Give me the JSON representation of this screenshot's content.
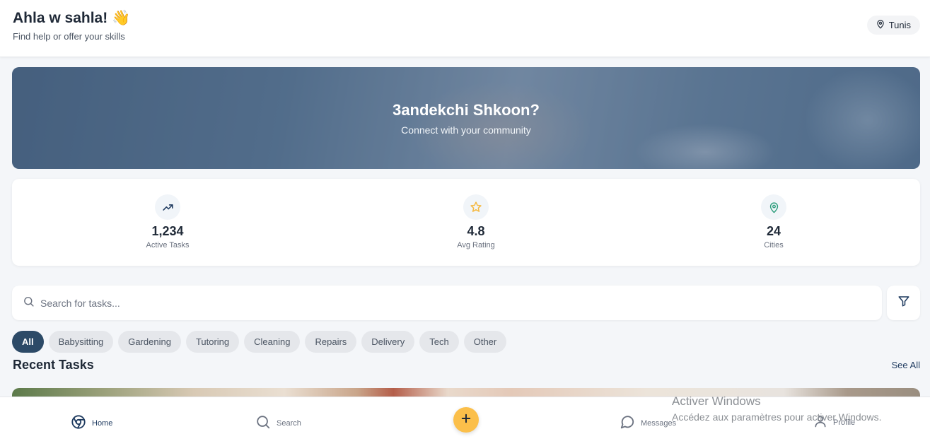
{
  "header": {
    "greeting": "Ahla w sahla! 👋",
    "subtitle": "Find help or offer your skills",
    "location": "Tunis",
    "location_icon": "map-pin-icon"
  },
  "hero": {
    "title": "3andekchi Shkoon?",
    "subtitle": "Connect with your community"
  },
  "stats": [
    {
      "icon": "trending-up-icon",
      "value": "1,234",
      "label": "Active Tasks",
      "color": "#1e3a5f"
    },
    {
      "icon": "star-icon",
      "value": "4.8",
      "label": "Avg Rating",
      "color": "#f5b942"
    },
    {
      "icon": "map-pin-icon",
      "value": "24",
      "label": "Cities",
      "color": "#2f9e7e"
    }
  ],
  "search": {
    "placeholder": "Search for tasks...",
    "value": ""
  },
  "categories": [
    {
      "label": "All",
      "active": true
    },
    {
      "label": "Babysitting",
      "active": false
    },
    {
      "label": "Gardening",
      "active": false
    },
    {
      "label": "Tutoring",
      "active": false
    },
    {
      "label": "Cleaning",
      "active": false
    },
    {
      "label": "Repairs",
      "active": false
    },
    {
      "label": "Delivery",
      "active": false
    },
    {
      "label": "Tech",
      "active": false
    },
    {
      "label": "Other",
      "active": false
    }
  ],
  "recent": {
    "title": "Recent Tasks",
    "see_all": "See All"
  },
  "nav": {
    "home": "Home",
    "search": "Search",
    "messages": "Messages",
    "profile": "Profile"
  },
  "watermark": {
    "title": "Activer Windows",
    "subtitle": "Accédez aux paramètres pour activer Windows."
  },
  "colors": {
    "primary": "#2c4a67",
    "accent": "#fbbf4a",
    "background": "#f4f6f9"
  }
}
